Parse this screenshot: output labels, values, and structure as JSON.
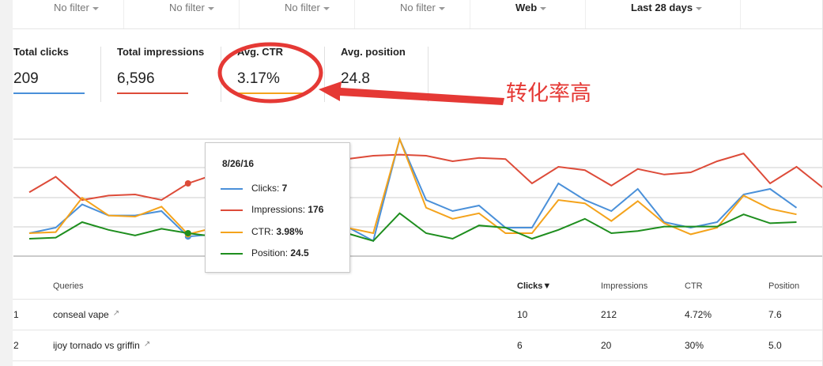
{
  "filters": [
    {
      "label": "No filter",
      "bold": false
    },
    {
      "label": "No filter",
      "bold": false
    },
    {
      "label": "No filter",
      "bold": false
    },
    {
      "label": "No filter",
      "bold": false
    },
    {
      "label": "Web",
      "bold": true
    },
    {
      "label": "Last 28 days",
      "bold": true
    }
  ],
  "metrics": [
    {
      "label": "Total clicks",
      "value": "209",
      "color": "#4a90d9"
    },
    {
      "label": "Total impressions",
      "value": "6,596",
      "color": "#dd4b39"
    },
    {
      "label": "Avg. CTR",
      "value": "3.17%",
      "color": "#f4a31c"
    },
    {
      "label": "Avg. position",
      "value": "24.8",
      "color": "#1e8e1e"
    }
  ],
  "annotation": {
    "text": "转化率高",
    "color": "#e53935"
  },
  "tooltip": {
    "date": "8/26/16",
    "rows": [
      {
        "name": "Clicks",
        "value": "7",
        "color": "#4a90d9"
      },
      {
        "name": "Impressions",
        "value": "176",
        "color": "#dd4b39"
      },
      {
        "name": "CTR",
        "value": "3.98%",
        "color": "#f4a31c"
      },
      {
        "name": "Position",
        "value": "24.5",
        "color": "#1e8e1e"
      }
    ]
  },
  "chart_data": {
    "type": "line",
    "title": "",
    "xlabel": "",
    "ylabel": "",
    "grid": true,
    "x_count": 29,
    "ylim": [
      0,
      100
    ],
    "series": [
      {
        "name": "Clicks",
        "color": "#4a90d9",
        "values": [
          15,
          20,
          41,
          31,
          31,
          35,
          12,
          14,
          20,
          35,
          42,
          26,
          21,
          8,
          100,
          45,
          35,
          40,
          20,
          20,
          60,
          45,
          35,
          55,
          25,
          20,
          25,
          50,
          55,
          38
        ]
      },
      {
        "name": "Impressions",
        "color": "#dd4b39",
        "values": [
          52,
          66,
          45,
          49,
          50,
          45,
          60,
          68,
          62,
          55,
          65,
          70,
          82,
          85,
          86,
          85,
          80,
          83,
          82,
          60,
          75,
          72,
          58,
          73,
          68,
          70,
          80,
          87,
          60,
          75,
          56
        ]
      },
      {
        "name": "CTR",
        "color": "#f4a31c",
        "values": [
          15,
          16,
          47,
          31,
          30,
          39,
          14,
          20,
          23,
          25,
          40,
          40,
          20,
          15,
          100,
          38,
          28,
          33,
          15,
          15,
          45,
          42,
          26,
          44,
          24,
          14,
          20,
          49,
          37,
          32
        ]
      },
      {
        "name": "Position",
        "color": "#1e8e1e",
        "values": [
          10,
          11,
          25,
          18,
          13,
          19,
          15,
          12,
          14,
          18,
          22,
          25,
          15,
          8,
          33,
          15,
          10,
          22,
          20,
          10,
          18,
          28,
          15,
          17,
          21,
          21,
          21,
          32,
          24,
          25
        ]
      }
    ]
  },
  "table": {
    "headers": {
      "queries": "Queries",
      "clicks": "Clicks▼",
      "impressions": "Impressions",
      "ctr": "CTR",
      "position": "Position"
    },
    "rows": [
      {
        "rank": "1",
        "query": "conseal vape",
        "clicks": "10",
        "impressions": "212",
        "ctr": "4.72%",
        "position": "7.6"
      },
      {
        "rank": "2",
        "query": "ijoy tornado vs griffin",
        "clicks": "6",
        "impressions": "20",
        "ctr": "30%",
        "position": "5.0"
      }
    ]
  }
}
